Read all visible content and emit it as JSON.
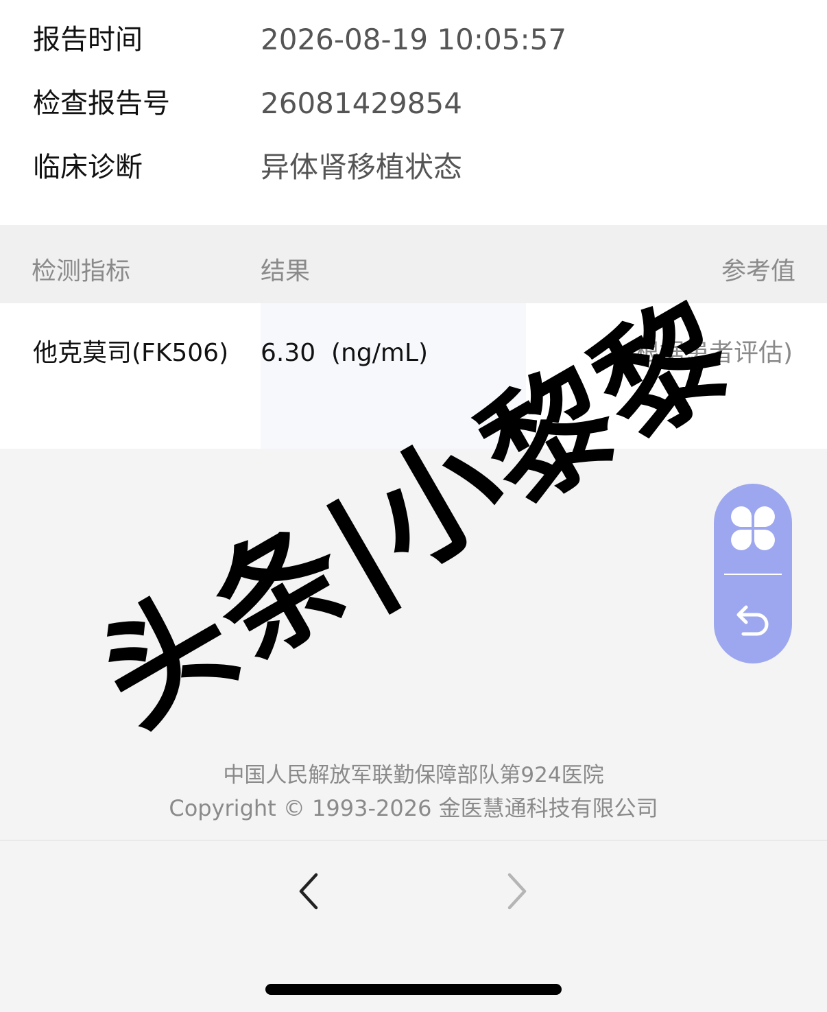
{
  "report_info": {
    "rows": [
      {
        "label": "报告时间",
        "value": "2026-08-19 10:05:57"
      },
      {
        "label": "检查报告号",
        "value": "26081429854"
      },
      {
        "label": "临床诊断",
        "value": "异体肾移植状态"
      }
    ]
  },
  "results_table": {
    "headers": {
      "indicator": "检测指标",
      "result": "结果",
      "reference": "参考值"
    },
    "rows": [
      {
        "indicator": "他克莫司(FK506)",
        "result": "6.30  (ng/mL)",
        "reference": "(根据患者评估)"
      }
    ]
  },
  "watermark": "头条|小黎黎",
  "floating_toolbar": {
    "accent_color": "#9da7ef",
    "buttons": [
      {
        "icon": "clover-icon"
      },
      {
        "icon": "undo-icon"
      }
    ]
  },
  "footer": {
    "hospital": "中国人民解放军联勤保障部队第924医院",
    "copyright": "Copyright © 1993-2026 金医慧通科技有限公司"
  },
  "browser_nav": {
    "back_icon": "chevron-left-icon",
    "forward_icon": "chevron-right-icon",
    "forward_enabled": false
  }
}
